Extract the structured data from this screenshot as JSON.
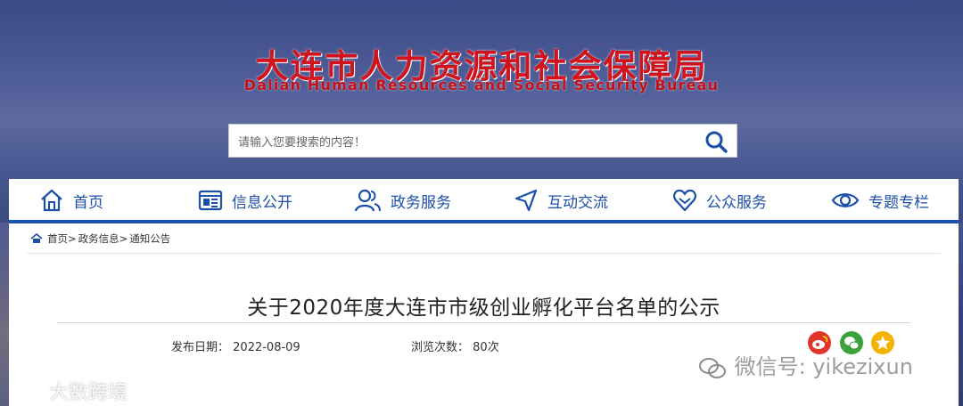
{
  "header": {
    "title": "大连市人力资源和社会保障局",
    "subtitle": "Dalian Human Resources and Social Security Bureau"
  },
  "search": {
    "placeholder": "请输入您要搜索的内容！"
  },
  "nav": {
    "items": [
      {
        "label": "首页",
        "icon": "home-icon"
      },
      {
        "label": "信息公开",
        "icon": "info-board-icon"
      },
      {
        "label": "政务服务",
        "icon": "people-icon"
      },
      {
        "label": "互动交流",
        "icon": "send-arrow-icon"
      },
      {
        "label": "公众服务",
        "icon": "heart-icon"
      },
      {
        "label": "专题专栏",
        "icon": "eye-icon"
      }
    ],
    "accent_color": "#1a55b5"
  },
  "breadcrumb": {
    "items": [
      "首页>",
      "政务信息>",
      "通知公告"
    ]
  },
  "article": {
    "title": "关于2020年度大连市市级创业孵化平台名单的公示",
    "publish_label": "发布日期：",
    "publish_date": "2022-08-09",
    "views_label": "浏览次数：",
    "views_value": "80次"
  },
  "share": {
    "icons": [
      "weibo-icon",
      "wechat-icon",
      "star-icon"
    ]
  },
  "watermarks": {
    "left": "大数跨境",
    "right": "微信号: yikezixun"
  }
}
